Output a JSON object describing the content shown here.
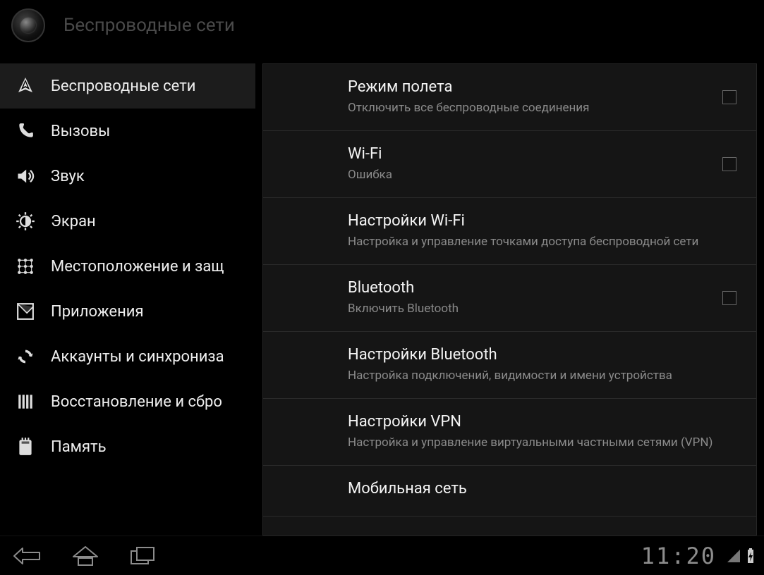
{
  "header": {
    "title": "Беспроводные сети"
  },
  "sidebar": {
    "items": [
      {
        "label": "Беспроводные сети",
        "icon": "wifi",
        "active": true
      },
      {
        "label": "Вызовы",
        "icon": "phone",
        "active": false
      },
      {
        "label": "Звук",
        "icon": "sound",
        "active": false
      },
      {
        "label": "Экран",
        "icon": "display",
        "active": false
      },
      {
        "label": "Местоположение и защ",
        "icon": "location",
        "active": false
      },
      {
        "label": "Приложения",
        "icon": "apps",
        "active": false
      },
      {
        "label": "Аккаунты и синхрониза",
        "icon": "sync",
        "active": false
      },
      {
        "label": "Восстановление и сбро",
        "icon": "privacy",
        "active": false
      },
      {
        "label": "Память",
        "icon": "storage",
        "active": false
      }
    ]
  },
  "content": {
    "items": [
      {
        "title": "Режим полета",
        "sub": "Отключить все беспроводные соединения",
        "checkbox": true
      },
      {
        "title": "Wi-Fi",
        "sub": "Ошибка",
        "checkbox": true
      },
      {
        "title": "Настройки Wi-Fi",
        "sub": "Настройка и управление точками доступа беспроводной сети",
        "checkbox": false
      },
      {
        "title": "Bluetooth",
        "sub": "Включить Bluetooth",
        "checkbox": true
      },
      {
        "title": "Настройки Bluetooth",
        "sub": "Настройка подключений, видимости и имени устройства",
        "checkbox": false
      },
      {
        "title": "Настройки VPN",
        "sub": "Настройка и управление виртуальными частными сетями (VPN)",
        "checkbox": false
      },
      {
        "title": "Мобильная сеть",
        "sub": "",
        "checkbox": false
      }
    ]
  },
  "statusbar": {
    "time": "11:20"
  }
}
